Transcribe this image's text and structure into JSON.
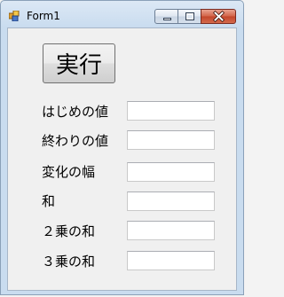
{
  "window": {
    "title": "Form1",
    "icon": "winforms-app-icon",
    "caption_buttons": [
      "minimize-icon",
      "maximize-icon",
      "close-icon"
    ]
  },
  "form": {
    "run_button_label": "実行",
    "fields": [
      {
        "label": "はじめの値",
        "value": ""
      },
      {
        "label": "終わりの値",
        "value": ""
      },
      {
        "label": "変化の幅",
        "value": ""
      },
      {
        "label": "和",
        "value": ""
      },
      {
        "label": "２乗の和",
        "value": ""
      },
      {
        "label": "３乗の和",
        "value": ""
      }
    ]
  },
  "colors": {
    "titlebar": "#c9dcef",
    "client_background": "#f0f0f0",
    "close_button": "#c3452a"
  }
}
